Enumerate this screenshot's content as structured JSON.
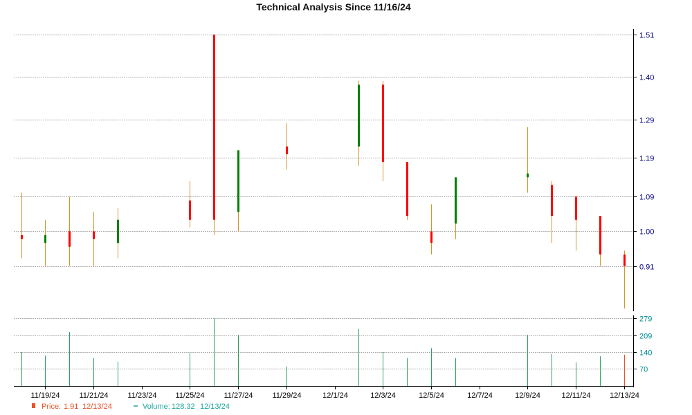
{
  "chart_data": {
    "type": "candlestick",
    "title": "Technical Analysis Since 11/16/24",
    "colors": {
      "up": "#008000",
      "down": "#ff0000",
      "wick": "#d4952a",
      "volume": "#2e9e5e",
      "volume_last": "#e8532a",
      "grid": "#b0b0b0",
      "price_axis_text": "#000080",
      "volume_axis_text": "#008b8b",
      "price_legend": "#e8532a",
      "volume_legend": "#1ba39c"
    },
    "price_axis": {
      "ticks": [
        "1.51",
        "1.40",
        "1.29",
        "1.19",
        "1.09",
        "1.00",
        "0.91"
      ],
      "range": [
        0.8,
        1.51
      ]
    },
    "volume_axis": {
      "ticks": [
        "279",
        "209",
        "140",
        "70"
      ],
      "range": [
        0,
        279
      ]
    },
    "x_tick_labels": [
      "11/19/24",
      "11/21/24",
      "11/23/24",
      "11/25/24",
      "11/27/24",
      "11/29/24",
      "12/1/24",
      "12/3/24",
      "12/5/24",
      "12/7/24",
      "12/9/24",
      "12/11/24",
      "12/13/24"
    ],
    "x_tick_days": [
      3,
      5,
      7,
      9,
      11,
      13,
      15,
      17,
      19,
      21,
      23,
      25,
      27
    ],
    "candles": [
      {
        "date": "11/18/24",
        "day": 2,
        "open": 0.99,
        "close": 0.98,
        "high": 1.1,
        "low": 0.93,
        "volume": 140
      },
      {
        "date": "11/19/24",
        "day": 3,
        "open": 0.97,
        "close": 0.99,
        "high": 1.03,
        "low": 0.91,
        "volume": 125
      },
      {
        "date": "11/20/24",
        "day": 4,
        "open": 1.0,
        "close": 0.96,
        "high": 1.09,
        "low": 0.91,
        "volume": 222
      },
      {
        "date": "11/21/24",
        "day": 5,
        "open": 1.0,
        "close": 0.98,
        "high": 1.05,
        "low": 0.91,
        "volume": 115
      },
      {
        "date": "11/22/24",
        "day": 6,
        "open": 0.97,
        "close": 1.03,
        "high": 1.06,
        "low": 0.93,
        "volume": 100
      },
      {
        "date": "11/25/24",
        "day": 9,
        "open": 1.08,
        "close": 1.03,
        "high": 1.13,
        "low": 1.01,
        "volume": 135
      },
      {
        "date": "11/26/24",
        "day": 10,
        "open": 1.51,
        "close": 1.03,
        "high": 1.51,
        "low": 0.99,
        "volume": 279
      },
      {
        "date": "11/27/24",
        "day": 11,
        "open": 1.05,
        "close": 1.21,
        "high": 1.21,
        "low": 1.0,
        "volume": 210
      },
      {
        "date": "11/29/24",
        "day": 13,
        "open": 1.22,
        "close": 1.2,
        "high": 1.28,
        "low": 1.16,
        "volume": 80
      },
      {
        "date": "12/2/24",
        "day": 16,
        "open": 1.22,
        "close": 1.38,
        "high": 1.39,
        "low": 1.17,
        "volume": 235
      },
      {
        "date": "12/3/24",
        "day": 17,
        "open": 1.38,
        "close": 1.18,
        "high": 1.39,
        "low": 1.13,
        "volume": 140
      },
      {
        "date": "12/4/24",
        "day": 18,
        "open": 1.18,
        "close": 1.04,
        "high": 1.18,
        "low": 1.03,
        "volume": 115
      },
      {
        "date": "12/5/24",
        "day": 19,
        "open": 1.0,
        "close": 0.97,
        "high": 1.07,
        "low": 0.94,
        "volume": 155
      },
      {
        "date": "12/6/24",
        "day": 20,
        "open": 1.02,
        "close": 1.14,
        "high": 1.14,
        "low": 0.98,
        "volume": 115
      },
      {
        "date": "12/9/24",
        "day": 23,
        "open": 1.14,
        "close": 1.15,
        "high": 1.27,
        "low": 1.1,
        "volume": 210
      },
      {
        "date": "12/10/24",
        "day": 24,
        "open": 1.12,
        "close": 1.04,
        "high": 1.13,
        "low": 0.97,
        "volume": 132
      },
      {
        "date": "12/11/24",
        "day": 25,
        "open": 1.09,
        "close": 1.03,
        "high": 1.09,
        "low": 0.95,
        "volume": 97
      },
      {
        "date": "12/12/24",
        "day": 26,
        "open": 1.04,
        "close": 0.94,
        "high": 1.04,
        "low": 0.91,
        "volume": 122
      },
      {
        "date": "12/13/24",
        "day": 27,
        "open": 0.94,
        "close": 0.91,
        "high": 0.95,
        "low": 0.8,
        "volume": 128.32
      }
    ],
    "legend": {
      "price_label": "Price:",
      "price_value": "1.91",
      "price_date": "12/13/24",
      "volume_label": "Volume:",
      "volume_value": "128.32",
      "volume_date": "12/13/24"
    },
    "grid": true
  }
}
